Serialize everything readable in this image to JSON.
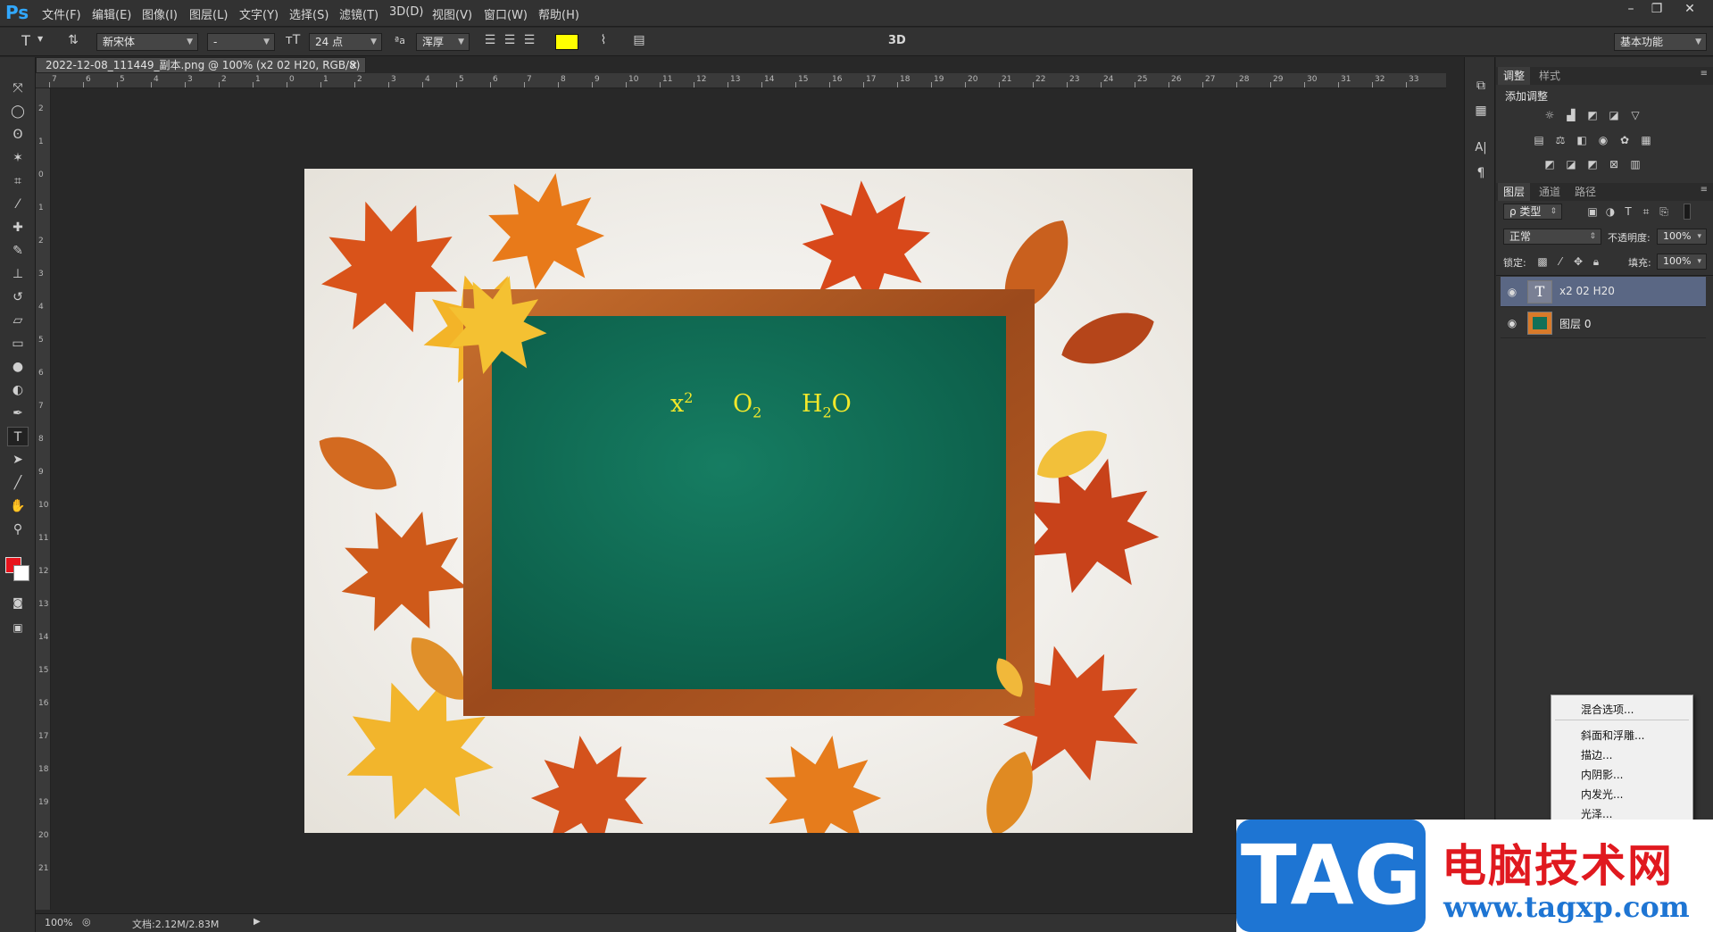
{
  "app": {
    "logo": "Ps",
    "menus": [
      "文件(F)",
      "编辑(E)",
      "图像(I)",
      "图层(L)",
      "文字(Y)",
      "选择(S)",
      "滤镜(T)",
      "3D(D)",
      "视图(V)",
      "窗口(W)",
      "帮助(H)"
    ],
    "window_buttons": {
      "minimize": "–",
      "restore": "❐",
      "close": "✕"
    }
  },
  "options_bar": {
    "tool_icon": "T",
    "font_family": "新宋体",
    "font_style": "-",
    "font_size": "24 点",
    "aa_icon": "ªa",
    "antialias": "浑厚",
    "text_color": "#ffff00",
    "threeD": "3D",
    "workspace": "基本功能"
  },
  "document": {
    "tab_title": "2022-12-08_111449_副本.png @ 100% (x2  02  H20, RGB/8) *",
    "tab_close": "×",
    "ruler_top": [
      "7",
      "6",
      "5",
      "4",
      "3",
      "2",
      "1",
      "0",
      "1",
      "2",
      "3",
      "4",
      "5",
      "6",
      "7",
      "8",
      "9",
      "10",
      "11",
      "12",
      "13",
      "14",
      "15",
      "16",
      "17",
      "18",
      "19",
      "20",
      "21",
      "22",
      "23",
      "24",
      "25",
      "26",
      "27",
      "28",
      "29",
      "30",
      "31",
      "32",
      "33"
    ],
    "ruler_left": [
      "2",
      "1",
      "0",
      "1",
      "2",
      "3",
      "4",
      "5",
      "6",
      "7",
      "8",
      "9",
      "10",
      "11",
      "12",
      "13",
      "14",
      "15",
      "16",
      "17",
      "18",
      "19",
      "20",
      "21"
    ]
  },
  "canvas": {
    "board_text": {
      "x": "x",
      "x_sup": "2",
      "o": "O",
      "o_sub": "2",
      "h": "H",
      "h_sub": "2",
      "h_tail": "O"
    },
    "text_color": "#f2e82a",
    "board_color": "#13715a",
    "frame_color": "#b05a22"
  },
  "status_bar": {
    "zoom": "100%",
    "doc_info": "文档:2.12M/2.83M"
  },
  "adjustments_panel": {
    "tabs": [
      "调整",
      "样式"
    ],
    "title": "添加调整",
    "icons_row1": [
      "brightness-icon",
      "levels-icon",
      "curves-icon",
      "exposure-icon",
      "vibrance-icon"
    ],
    "icons_row2": [
      "hue-icon",
      "color-balance-icon",
      "bw-icon",
      "photo-filter-icon",
      "channel-mixer-icon",
      "lookup-icon"
    ],
    "icons_row3": [
      "invert-icon",
      "posterize-icon",
      "threshold-icon",
      "selective-color-icon",
      "gradient-map-icon"
    ]
  },
  "layers_panel": {
    "tabs": [
      "图层",
      "通道",
      "路径"
    ],
    "filter_kind": "ρ 类型",
    "blend_mode": "正常",
    "opacity_label": "不透明度:",
    "opacity_value": "100%",
    "lock_label": "锁定:",
    "fill_label": "填充:",
    "fill_value": "100%",
    "layers": [
      {
        "name": "x2  02  H20",
        "type": "text",
        "selected": true
      },
      {
        "name": "图层 0",
        "type": "image",
        "selected": false
      }
    ]
  },
  "context_menu": {
    "items": [
      "混合选项...",
      "斜面和浮雕...",
      "描边...",
      "内阴影...",
      "内发光...",
      "光泽..."
    ]
  },
  "watermark": {
    "tag": "TAG",
    "cn": "电脑技术网",
    "url": "www.tagxp.com"
  }
}
